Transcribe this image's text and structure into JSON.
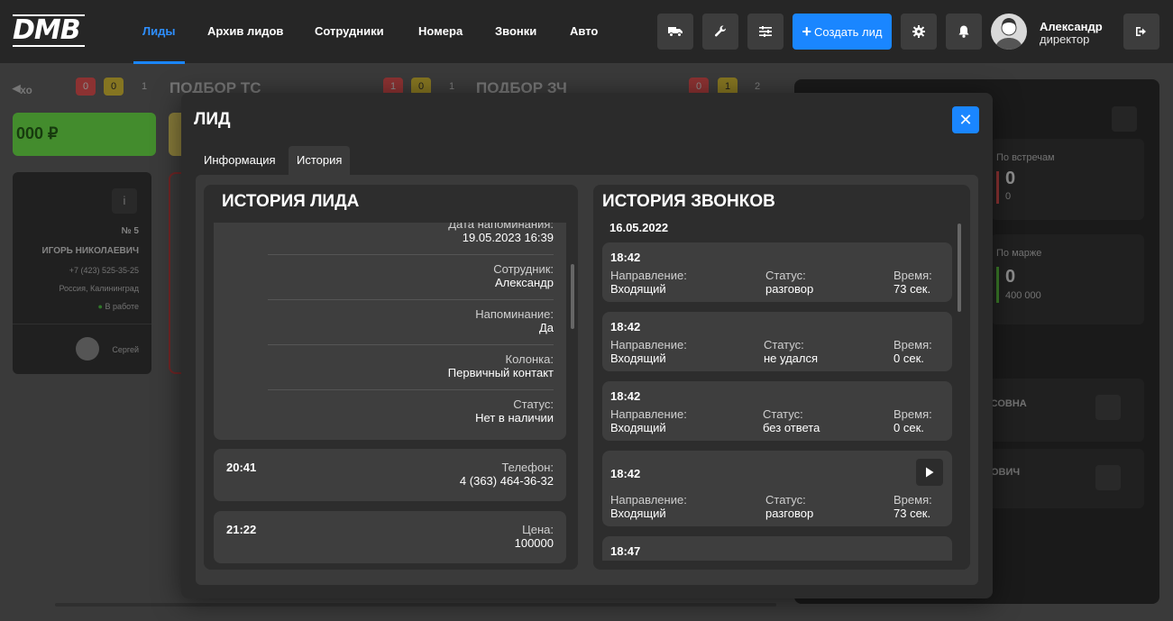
{
  "nav": {
    "logo": "DMB",
    "items": [
      {
        "label": "Лиды",
        "active": true
      },
      {
        "label": "Архив лидов",
        "active": false
      },
      {
        "label": "Сотрудники",
        "active": false
      },
      {
        "label": "Номера",
        "active": false
      },
      {
        "label": "Звонки",
        "active": false
      },
      {
        "label": "Авто",
        "active": false
      }
    ],
    "icons": [
      "truck-icon",
      "wrench-icon",
      "sliders-icon"
    ],
    "create_label": "Создать лид",
    "user": {
      "name": "Александр",
      "role": "директор"
    },
    "accent": "#1a86ff"
  },
  "board": {
    "columns": [
      {
        "title": "",
        "counts": [
          "0",
          "0",
          "1"
        ]
      },
      {
        "title": "ПОДБОР ТС",
        "counts": [
          "1",
          "0",
          "1"
        ]
      },
      {
        "title": "ПОДБОР ЗЧ",
        "counts": [
          "0",
          "1",
          "2"
        ]
      }
    ],
    "sum_label": "000 ₽",
    "card": {
      "number": "№ 5",
      "name": "ИГОРЬ НИКОЛАЕВИЧ",
      "phone": "+7 (423) 525-35-25",
      "city": "Россия, Калининград",
      "status": "В работе",
      "employee": "Сергей"
    },
    "right_panel": {
      "stat1_label": "По встречам",
      "stat1_value": "0",
      "stat1_sub": "0",
      "stat2_label": "По марже",
      "stat2_value": "0",
      "stat2_sub": "400 000",
      "item1": "АСОВНА",
      "item2": "НОВИЧ"
    }
  },
  "modal": {
    "title": "ЛИД",
    "tabs": [
      {
        "label": "Информация",
        "active": false
      },
      {
        "label": "История",
        "active": true
      }
    ],
    "lead_history": {
      "title": "ИСТОРИЯ ЛИДА",
      "first_entry": [
        {
          "key": "Дата напоминания:",
          "value": "19.05.2023 16:39"
        },
        {
          "key": "Сотрудник:",
          "value": "Александр"
        },
        {
          "key": "Напоминание:",
          "value": "Да"
        },
        {
          "key": "Колонка:",
          "value": "Первичный контакт"
        },
        {
          "key": "Статус:",
          "value": "Нет в наличии"
        }
      ],
      "entries": [
        {
          "time": "20:41",
          "key": "Телефон:",
          "value": "4 (363) 464-36-32"
        },
        {
          "time": "21:22",
          "key": "Цена:",
          "value": "100000"
        }
      ]
    },
    "call_history": {
      "title": "ИСТОРИЯ ЗВОНКОВ",
      "date": "16.05.2022",
      "labels": {
        "direction": "Направление:",
        "status": "Статус:",
        "duration": "Время:"
      },
      "calls": [
        {
          "time": "18:42",
          "direction": "Входящий",
          "status": "разговор",
          "duration": "73 сек.",
          "has_play": false
        },
        {
          "time": "18:42",
          "direction": "Входящий",
          "status": "не удался",
          "duration": "0 сек.",
          "has_play": false
        },
        {
          "time": "18:42",
          "direction": "Входящий",
          "status": "без ответа",
          "duration": "0 сек.",
          "has_play": false
        },
        {
          "time": "18:42",
          "direction": "Входящий",
          "status": "разговор",
          "duration": "73 сек.",
          "has_play": true
        },
        {
          "time": "18:47",
          "direction": "",
          "status": "",
          "duration": "",
          "has_play": false
        }
      ]
    }
  }
}
